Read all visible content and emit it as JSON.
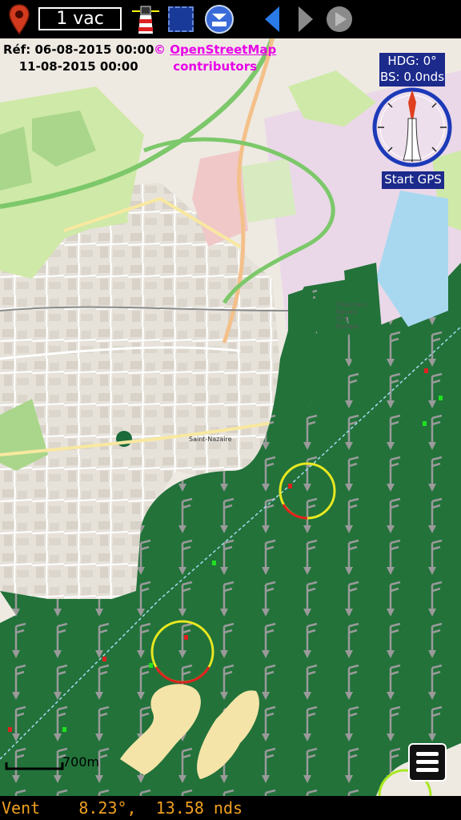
{
  "toolbar": {
    "vac_label": "1 vac",
    "icons": [
      "location-pin-icon",
      "lighthouse-icon",
      "selection-square-icon",
      "download-icon",
      "arrow-left-icon",
      "arrow-right-icon",
      "play-icon"
    ]
  },
  "map": {
    "ref_line1": "Réf: 06-08-2015 00:00",
    "ref_line2": "11-08-2015 00:00",
    "credit_prefix": "©",
    "credit_link": "OpenStreetMap",
    "credit_line2": "contributors",
    "place_labels": [
      "Saint-Nazaire",
      "Chantiers Navals STX Europe"
    ],
    "scale_label": "700m"
  },
  "nav": {
    "heading": "HDG: 0°",
    "boat_speed": "BS: 0.0nds",
    "gps_button": "Start GPS"
  },
  "status": {
    "wind_text": "Vent    8.23°,  13.58 nds"
  },
  "colors": {
    "sea": "#22723a",
    "land": "#eeeae2",
    "park": "#cfe9a8",
    "industrial": "#ead8e8",
    "wind_arrow": "#9a9a9a",
    "status_text": "#f0a020",
    "credit": "#e800e8",
    "nav_box": "#1c2a8c"
  }
}
